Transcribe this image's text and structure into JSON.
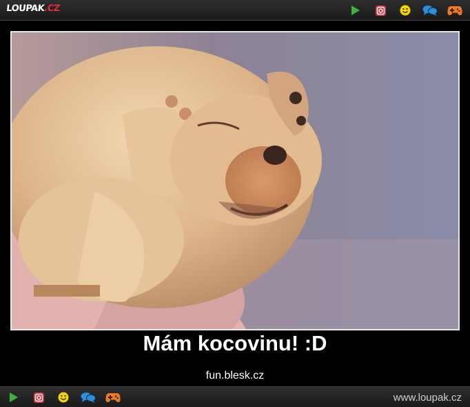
{
  "top_bar": {
    "logo": {
      "part1": "LOUPAK",
      "part2": ".CZ"
    },
    "icons": [
      "play-icon",
      "instagram-icon",
      "smiley-icon",
      "chat-icon",
      "gamepad-icon"
    ]
  },
  "post": {
    "image_alt": "Puppy covering its face with its paws",
    "caption": "Mám kocovinu! :D",
    "source": "fun.blesk.cz"
  },
  "bottom_bar": {
    "icons": [
      "play-icon",
      "instagram-icon",
      "smiley-icon",
      "chat-icon",
      "gamepad-icon"
    ],
    "site_url": "www.loupak.cz"
  },
  "colors": {
    "background": "#000000",
    "bar": "#222222",
    "logo_accent": "#e0303a",
    "play": "#3cb43c",
    "instagram": "#d8323c",
    "smiley": "#f2d500",
    "chat": "#2a8fe0",
    "gamepad": "#f07a1a"
  }
}
